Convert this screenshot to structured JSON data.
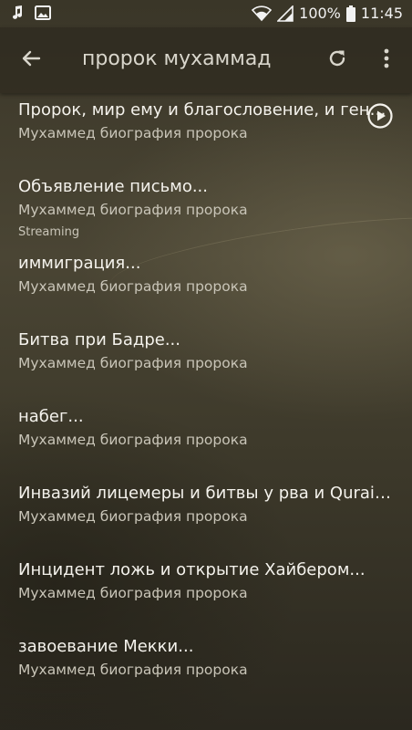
{
  "status_bar": {
    "battery_percent": "100%",
    "time": "11:45",
    "icons": [
      "music-note-icon",
      "image-icon",
      "wifi-icon",
      "signal-icon",
      "battery-icon"
    ]
  },
  "toolbar": {
    "title": "пророк мухаммад",
    "icons": [
      "back-arrow-icon",
      "refresh-icon",
      "more-vert-icon"
    ]
  },
  "list": {
    "items": [
      {
        "title": "Пророк, мир ему и благословение, и генеалогия",
        "subtitle": "Мухаммед биография пророка"
      },
      {
        "title": "Объявление письмо...",
        "subtitle": "Мухаммед биография пророка",
        "extra": "Streaming",
        "playing_icon": "play-circle-icon"
      },
      {
        "title": "иммиграция...",
        "subtitle": "Мухаммед биография пророка"
      },
      {
        "title": "Битва при Бадре...",
        "subtitle": "Мухаммед биография пророка"
      },
      {
        "title": "набег...",
        "subtitle": "Мухаммед биография пророка"
      },
      {
        "title": "Инвазий лицемеры и битвы у рва и Quraiza",
        "subtitle": "Мухаммед биография пророка"
      },
      {
        "title": "Инцидент ложь и открытие Хайбером...",
        "subtitle": "Мухаммед биография пророка"
      },
      {
        "title": "завоевание Мекки...",
        "subtitle": "Мухаммед биография пророка"
      }
    ]
  },
  "colors": {
    "text_primary": "#f4f2ec",
    "text_secondary": "#c9c5b8",
    "background": "#3e3a2b"
  }
}
